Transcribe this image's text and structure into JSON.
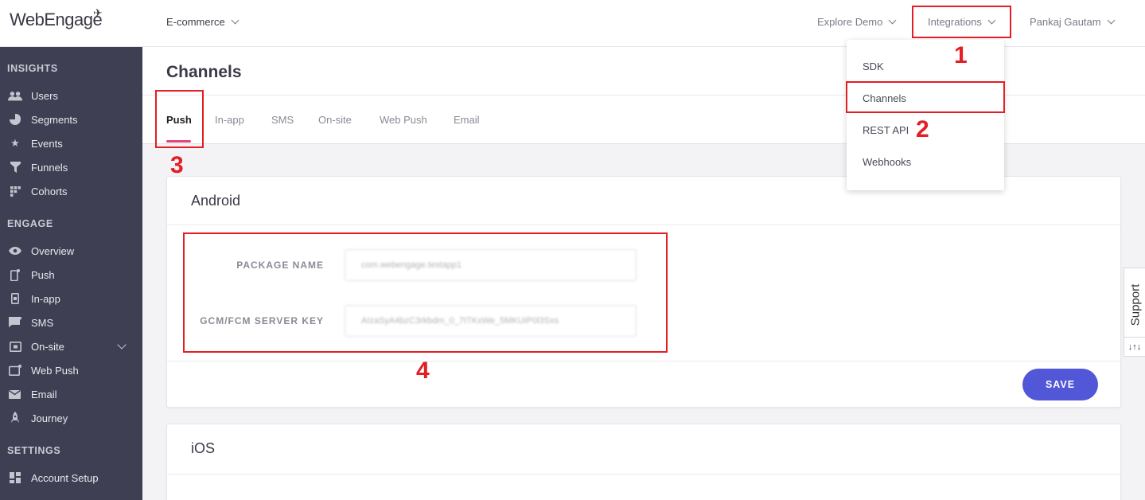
{
  "brand": {
    "logo_text": "WebEngage"
  },
  "header": {
    "project": "E-commerce",
    "explore_demo": "Explore Demo",
    "integrations": "Integrations",
    "user_name": "Pankaj Gautam"
  },
  "integrations_menu": [
    "SDK",
    "Channels",
    "REST API",
    "Webhooks"
  ],
  "sidebar": {
    "insights_title": "INSIGHTS",
    "insights": [
      "Users",
      "Segments",
      "Events",
      "Funnels",
      "Cohorts"
    ],
    "engage_title": "ENGAGE",
    "engage": [
      "Overview",
      "Push",
      "In-app",
      "SMS",
      "On-site",
      "Web Push",
      "Email",
      "Journey"
    ],
    "settings_title": "SETTINGS",
    "settings": [
      "Account Setup"
    ]
  },
  "page": {
    "title": "Channels",
    "tabs": [
      "Push",
      "In-app",
      "SMS",
      "On-site",
      "Web Push",
      "Email"
    ],
    "active_tab": "Push"
  },
  "android": {
    "title": "Android",
    "package_name_label": "PACKAGE NAME",
    "package_name_value": "com.webengage.testapp1",
    "server_key_label": "GCM/FCM SERVER KEY",
    "server_key_value": "AIzaSyA4bzC3rkbdm_0_7tTKxWe_5MKUIP0l3Sxs",
    "save_label": "SAVE"
  },
  "ios": {
    "title": "iOS"
  },
  "support": {
    "label": "Support",
    "icon_text": "↓↑↓"
  },
  "annotations": [
    "1",
    "2",
    "3",
    "4"
  ],
  "colors": {
    "sidebar_bg": "#3e3f52",
    "accent_tab": "#e0457b",
    "save_button": "#5157d6",
    "annotation_red": "#e31e24"
  }
}
